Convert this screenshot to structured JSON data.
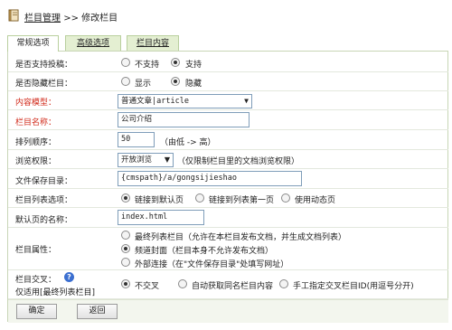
{
  "breadcrumb": {
    "section": "栏目管理",
    "separator": ">>",
    "current": "修改栏目"
  },
  "tabs": [
    {
      "label": "常规选项",
      "active": true
    },
    {
      "label": "高级选项",
      "active": false
    },
    {
      "label": "栏目内容",
      "active": false
    }
  ],
  "rows": {
    "submit": {
      "label": "是否支持投稿：",
      "options": [
        "不支持",
        "支持"
      ],
      "selected": "支持"
    },
    "hidden": {
      "label": "是否隐藏栏目：",
      "options": [
        "显示",
        "隐藏"
      ],
      "selected": "隐藏"
    },
    "content_model": {
      "label": "内容模型：",
      "value": "普通文章|article"
    },
    "column_name": {
      "label": "栏目名称：",
      "value": "公司介绍"
    },
    "sort_order": {
      "label": "排列顺序：",
      "value": "50",
      "note": "（由低 -> 高）"
    },
    "browse_permission": {
      "label": "浏览权限：",
      "value": "开放浏览",
      "note": "（仅限制栏目里的文档浏览权限）"
    },
    "save_dir": {
      "label": "文件保存目录：",
      "value": "{cmspath}/a/gongsijieshao"
    },
    "list_option": {
      "label": "栏目列表选项：",
      "options": [
        "链接到默认页",
        "链接到列表第一页",
        "使用动态页"
      ],
      "selected": "链接到默认页"
    },
    "default_page": {
      "label": "默认页的名称：",
      "value": "index.html"
    },
    "attribute": {
      "label": "栏目属性：",
      "options": [
        "最终列表栏目（允许在本栏目发布文档，并生成文档列表）",
        "频道封面（栏目本身不允许发布文档）",
        "外部连接（在\"文件保存目录\"处填写网址）"
      ],
      "selected": "频道封面（栏目本身不允许发布文档）"
    },
    "cross": {
      "label": "栏目交叉：",
      "sublabel": "仅适用[最终列表栏目]",
      "help": "?",
      "options": [
        "不交叉",
        "自动获取同名栏目内容",
        "手工指定交叉栏目ID(用逗号分开)"
      ],
      "selected": "不交叉"
    }
  },
  "buttons": {
    "confirm": "确定",
    "back": "返回"
  },
  "colors": {
    "required_label": "#d12a1a",
    "tab_bg": "#e4efd2",
    "tab_border": "#b9cf9e"
  }
}
